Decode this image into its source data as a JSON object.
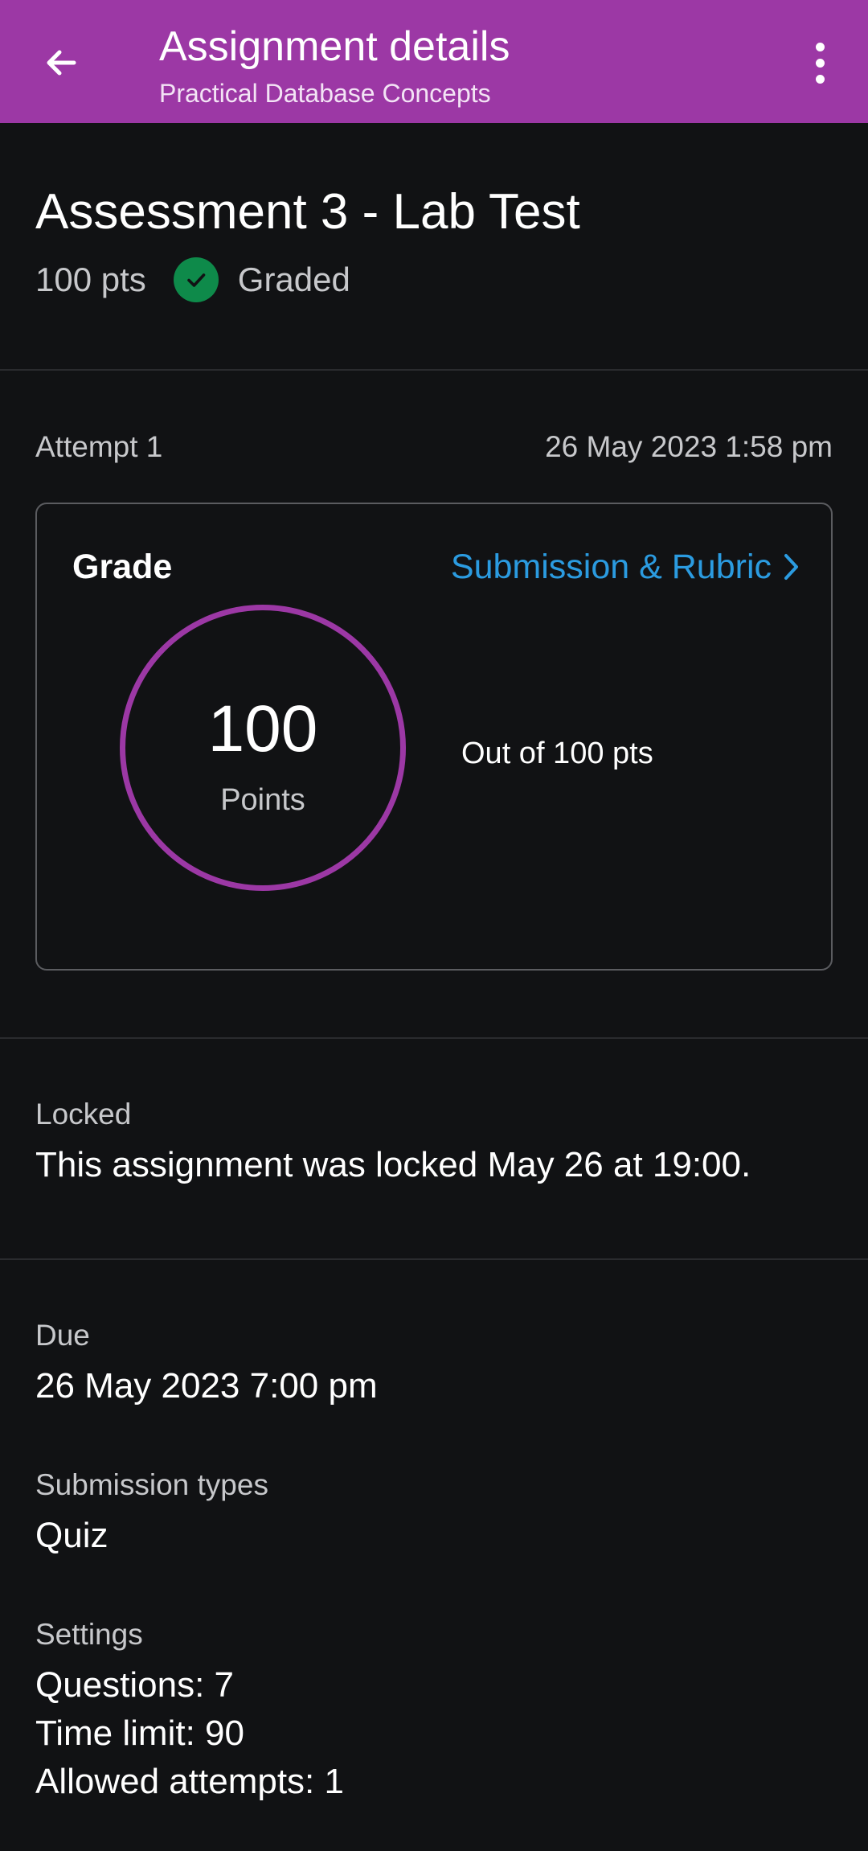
{
  "app_bar": {
    "title": "Assignment details",
    "subtitle": "Practical Database Concepts",
    "back_icon": "arrow-left-icon",
    "more_icon": "more-vertical-icon",
    "background_color": "#9c38a5"
  },
  "assignment": {
    "title": "Assessment 3 - Lab Test",
    "points": "100 pts",
    "status": "Graded",
    "status_icon": "check-circle-icon",
    "status_color": "#0e8a4a"
  },
  "attempt": {
    "label": "Attempt 1",
    "date": "26 May 2023 1:58 pm"
  },
  "grade": {
    "label": "Grade",
    "link_label": "Submission & Rubric",
    "link_icon": "chevron-right-icon",
    "link_color": "#2b9be0",
    "score": "100",
    "unit": "Points",
    "out_of": "Out of 100 pts",
    "ring_color": "#9c38a5"
  },
  "locked": {
    "label": "Locked",
    "text": "This assignment was locked May 26 at 19:00."
  },
  "due": {
    "label": "Due",
    "value": "26 May 2023 7:00 pm"
  },
  "submission_types": {
    "label": "Submission types",
    "value": "Quiz"
  },
  "settings": {
    "label": "Settings",
    "lines": [
      "Questions: 7",
      "Time limit: 90",
      "Allowed attempts: 1"
    ]
  }
}
